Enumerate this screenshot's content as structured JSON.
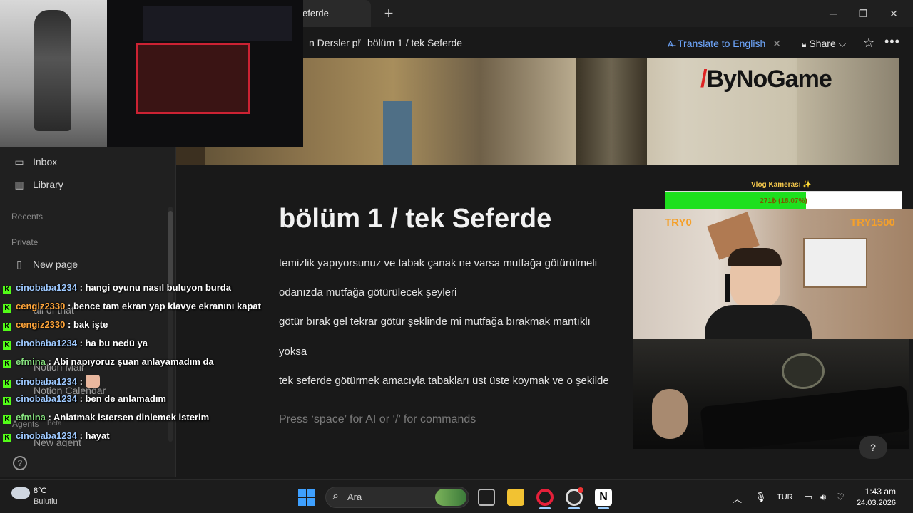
{
  "browser": {
    "tab_title": "eferde",
    "new_tab": "+",
    "minimize": "─",
    "restore": "❐",
    "close": "✕"
  },
  "header": {
    "breadcrumb_1": "n Dersler pl",
    "separator": "/",
    "breadcrumb_2": "bölüm 1 / tek Seferde",
    "translate_label": "Translate to English",
    "translate_close": "✕",
    "share_label": "Share ⌵",
    "star": "☆",
    "more": "•••"
  },
  "cover": {
    "brand_text": "ByNoGame"
  },
  "sidebar": {
    "items": [
      {
        "label": "Inbox",
        "icon": "inbox-icon",
        "glyph": "▭"
      },
      {
        "label": "Library",
        "icon": "library-icon",
        "glyph": "▥"
      }
    ],
    "recents_heading": "Recents",
    "private_heading": "Private",
    "new_page": "New page",
    "behind_overlay": {
      "all_of_that": "all of that",
      "notion_mail": "Notion Mail",
      "notion_calendar": "Notion Calendar",
      "agents": "Agents",
      "beta": "Beta",
      "new_agent": "New agent"
    },
    "help": "?"
  },
  "page": {
    "title": "bölüm 1 / tek Seferde",
    "paragraphs": [
      "temizlik yapıyorsunuz ve tabak çanak ne varsa mutfağa götürülmeli",
      "odanızda mutfağa götürülecek şeyleri",
      "götür bırak gel tekrar götür şeklinde mi mutfağa bırakmak mantıklı",
      "yoksa",
      "tek seferde götürmek amacıyla tabakları üst üste koymak ve o şekilde"
    ],
    "placeholder": "Press ‘space’ for AI or ‘/’ for commands",
    "help_button": "?"
  },
  "stream": {
    "vlog_title": "Vlog Kamerası ✨",
    "goal_text": "271₺ (18.07%)",
    "goal_fraction": 0.1807,
    "try_left": "TRY0",
    "try_right": "TRY1500"
  },
  "chat": [
    {
      "user": "cinobaba1234",
      "msg": ": hangi oyunu nasıl buluyon burda",
      "cls": "u1"
    },
    {
      "user": "cengiz2330",
      "msg": ": bence tam ekran yap klavye ekranını kapat",
      "cls": "u2"
    },
    {
      "user": "cengiz2330",
      "msg": ": bak işte",
      "cls": "u2"
    },
    {
      "user": "cinobaba1234",
      "msg": ": ha bu nedü ya",
      "cls": "u1"
    },
    {
      "user": "efmina",
      "msg": ": Abi napıyoruz şuan anlayamadım da",
      "cls": "u3"
    },
    {
      "user": "cinobaba1234",
      "msg": ":",
      "cls": "u1",
      "emote": true
    },
    {
      "user": "cinobaba1234",
      "msg": ": ben de anlamadım",
      "cls": "u1"
    },
    {
      "user": "efmina",
      "msg": ": Anlatmak istersen dinlemek isterim",
      "cls": "u3"
    },
    {
      "user": "cinobaba1234",
      "msg": ": hayat",
      "cls": "u1"
    }
  ],
  "taskbar": {
    "temp": "8°C",
    "condition": "Bulutlu",
    "search_text": "Ara",
    "language": "TUR",
    "time": "1:43 am",
    "date": "24.03.2026",
    "tray_up": "︿",
    "apps": [
      {
        "name": "task-view-icon",
        "color": "#b8b8b8"
      },
      {
        "name": "file-explorer-icon",
        "color": "#f2c232"
      },
      {
        "name": "opera-icon",
        "color": "#e5203a"
      },
      {
        "name": "obs-icon",
        "color": "#dcdcdc"
      },
      {
        "name": "notion-icon",
        "color": "#ffffff"
      }
    ]
  },
  "colors": {
    "background": "#191919",
    "accent_blue": "#6fa8ff",
    "chat_badge": "#53fc18",
    "goal_fill": "#1ee01e"
  }
}
